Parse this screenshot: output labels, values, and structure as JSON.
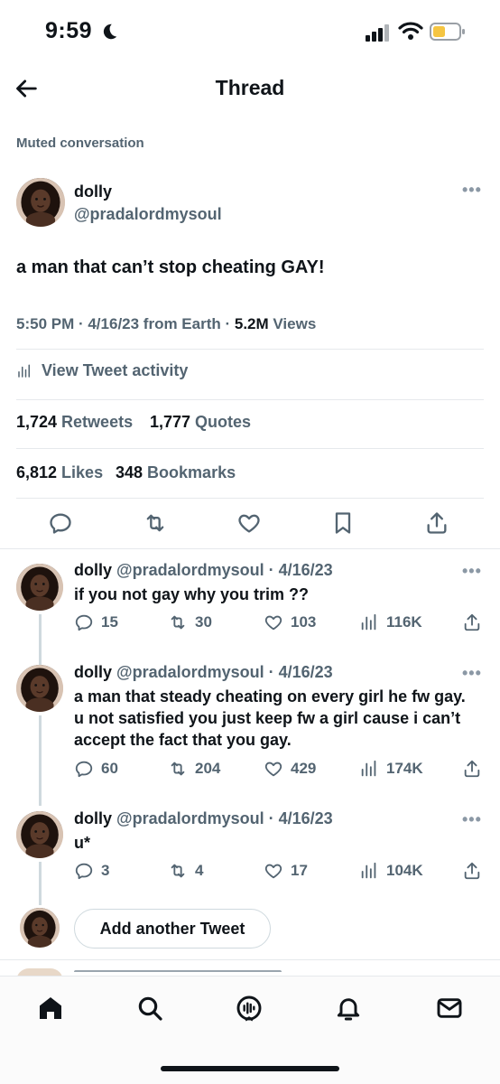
{
  "status_bar": {
    "time": "9:59"
  },
  "header": {
    "title": "Thread"
  },
  "muted_label": "Muted conversation",
  "main_tweet": {
    "name": "dolly",
    "handle": "@pradalordmysoul",
    "text": "a man that can’t stop cheating GAY!",
    "time": "5:50 PM · 4/16/23 from Earth · ",
    "views_count": "5.2M",
    "views_label": " Views",
    "activity_label": "View Tweet activity",
    "retweets_count": "1,724",
    "retweets_label": " Retweets",
    "quotes_count": "1,777",
    "quotes_label": " Quotes",
    "likes_count": "6,812",
    "likes_label": " Likes",
    "bookmarks_count": "348",
    "bookmarks_label": " Bookmarks"
  },
  "replies": [
    {
      "name": "dolly",
      "meta": " @pradalordmysoul · 4/16/23",
      "text": "if you not gay why you trim ??",
      "replies": "15",
      "retweets": "30",
      "likes": "103",
      "views": "116K"
    },
    {
      "name": "dolly",
      "meta": " @pradalordmysoul · 4/16/23",
      "text": "a man that steady cheating on every girl he fw gay. u not satisfied you just keep fw a girl cause i can’t accept the fact that you gay.",
      "replies": "60",
      "retweets": "204",
      "likes": "429",
      "views": "174K"
    },
    {
      "name": "dolly",
      "meta": " @pradalordmysoul · 4/16/23",
      "text": "u*",
      "replies": "3",
      "retweets": "4",
      "likes": "17",
      "views": "104K"
    }
  ],
  "add_tweet_label": "Add another Tweet",
  "icons": {
    "back": "back-arrow-icon",
    "more": "more-dots-icon",
    "reply": "reply-icon",
    "retweet": "retweet-icon",
    "like": "like-icon",
    "bookmark": "bookmark-icon",
    "share": "share-icon",
    "views": "views-icon",
    "home": "home-icon",
    "search": "search-icon",
    "spaces": "spaces-icon",
    "notifications": "notifications-icon",
    "messages": "messages-icon"
  },
  "colors": {
    "text": "#0f1419",
    "secondary": "#536471",
    "divider": "#e6e9ec",
    "battery": "#f5c542"
  }
}
